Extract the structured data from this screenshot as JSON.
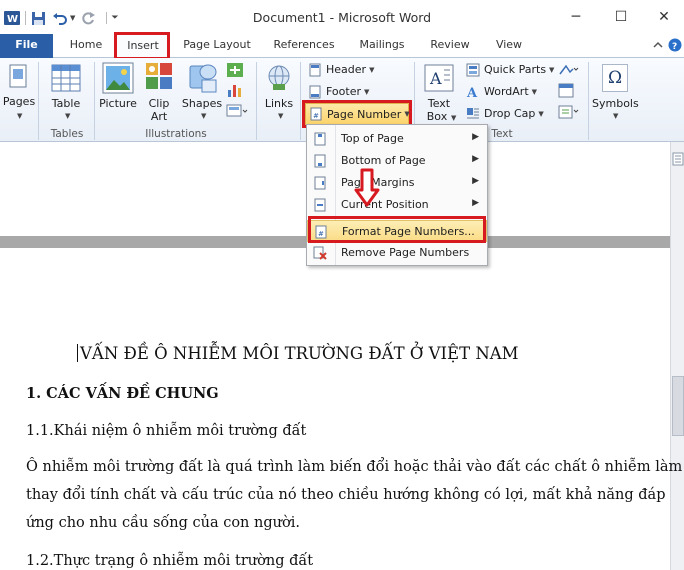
{
  "window": {
    "title": "Document1  -  Microsoft Word",
    "minimize": "─",
    "maximize": "☐",
    "close": "✕"
  },
  "tabs": [
    "File",
    "Home",
    "Insert",
    "Page Layout",
    "References",
    "Mailings",
    "Review",
    "View"
  ],
  "ribbon": {
    "pages": "Pages",
    "table": "Table",
    "tables_group": "Tables",
    "picture": "Picture",
    "clip_art_1": "Clip",
    "clip_art_2": "Art",
    "shapes": "Shapes",
    "illustrations_group": "Illustrations",
    "links": "Links",
    "header": "Header",
    "footer": "Footer",
    "page_number": "Page Number",
    "text_box_1": "Text",
    "text_box_2": "Box",
    "quick_parts": "Quick Parts",
    "wordart": "WordArt",
    "drop_cap": "Drop Cap",
    "text_group": "Text",
    "symbols": "Symbols",
    "omega": "Ω"
  },
  "menu": {
    "items": [
      {
        "label": "Top of Page",
        "submenu": true
      },
      {
        "label": "Bottom of Page",
        "submenu": true
      },
      {
        "label": "Page Margins",
        "submenu": true
      },
      {
        "label": "Current Position",
        "submenu": true
      },
      {
        "label": "Format Page Numbers...",
        "submenu": false
      },
      {
        "label": "Remove Page Numbers",
        "submenu": false
      }
    ]
  },
  "document": {
    "title": "VẤN ĐỀ Ô NHIỄM  MÔI TRƯỜNG ĐẤT Ở VIỆT NAM",
    "heading1": "1. CÁC VẤN ĐỀ CHUNG",
    "sub1": "1.1.Khái niệm ô nhiễm môi trường đất",
    "para_line1": "Ô nhiễm môi trường đất là quá trình làm biến đổi hoặc thải vào đất các chất ô nhiễm làm",
    "para_line2": "thay đổi tính chất và cấu trúc của nó theo chiều hướng không có lợi, mất khả năng đáp",
    "para_line3": "ứng cho nhu cầu sống của con người.",
    "sub2": "1.2.Thực trạng ô nhiễm môi trường đất"
  },
  "colors": {
    "highlight_red": "#d71920",
    "file_tab": "#2a5fa8",
    "hover_orange": "#fbd87a"
  }
}
